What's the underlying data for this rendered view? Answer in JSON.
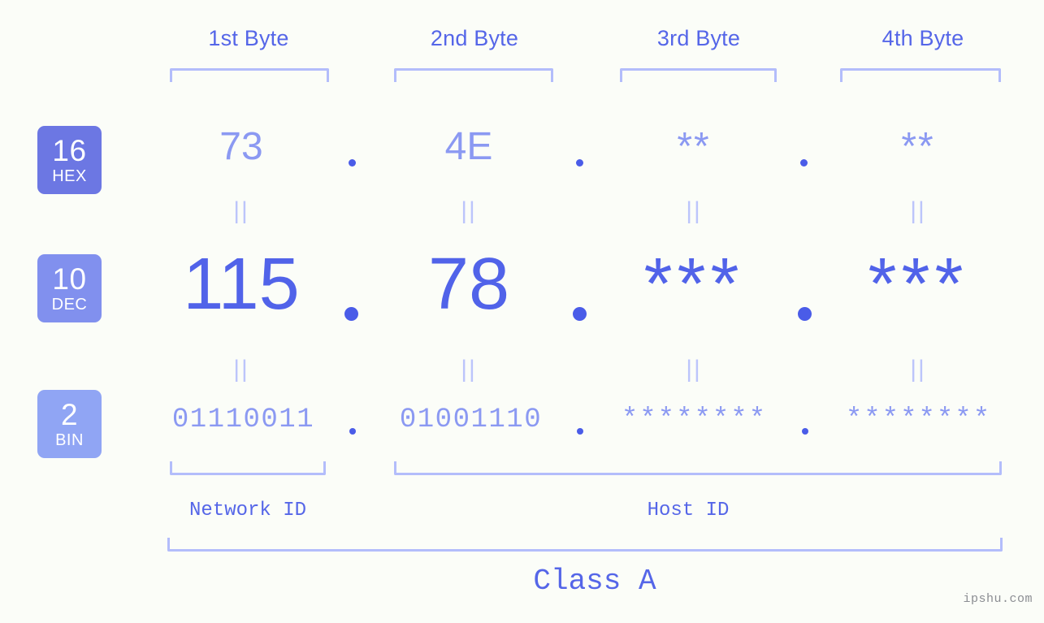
{
  "background_color": "#fbfdf8",
  "accent_color": "#5566e8",
  "muted_accent_color": "#8b99f2",
  "bracket_color": "#b3bdfb",
  "byte_headers": [
    {
      "label": "1st Byte"
    },
    {
      "label": "2nd Byte"
    },
    {
      "label": "3rd Byte"
    },
    {
      "label": "4th Byte"
    }
  ],
  "rows": [
    {
      "id": "hex",
      "badge_number": "16",
      "badge_abbr": "HEX",
      "badge_color": "#6c77e3",
      "values": [
        "73",
        "4E",
        "**",
        "**"
      ],
      "separator": "."
    },
    {
      "id": "dec",
      "badge_number": "10",
      "badge_abbr": "DEC",
      "badge_color": "#8190ee",
      "values": [
        "115",
        "78",
        "***",
        "***"
      ],
      "separator": "."
    },
    {
      "id": "bin",
      "badge_number": "2",
      "badge_abbr": "BIN",
      "badge_color": "#90a5f4",
      "values": [
        "01110011",
        "01001110",
        "********",
        "********"
      ],
      "separator": "."
    }
  ],
  "equality_marker": "||",
  "footer": {
    "network_id_label": "Network ID",
    "host_id_label": "Host ID",
    "class_label": "Class A"
  },
  "watermark": "ipshu.com"
}
